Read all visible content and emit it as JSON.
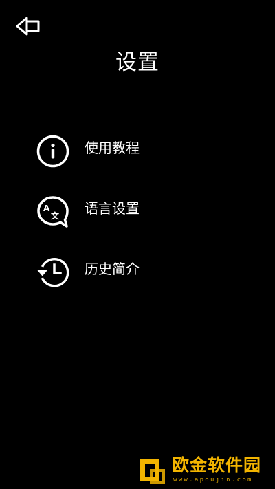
{
  "header": {
    "back_icon": "back-arrow-icon",
    "title": "设置"
  },
  "menu": {
    "items": [
      {
        "icon": "info-circle-icon",
        "label": "使用教程"
      },
      {
        "icon": "translate-bubble-icon",
        "label": "语言设置"
      },
      {
        "icon": "history-clock-icon",
        "label": "历史简介"
      }
    ]
  },
  "watermark": {
    "name": "欧金软件园",
    "url": "www.apoujin.com"
  },
  "colors": {
    "background": "#000000",
    "foreground": "#ffffff",
    "watermark": "#f2b400"
  }
}
